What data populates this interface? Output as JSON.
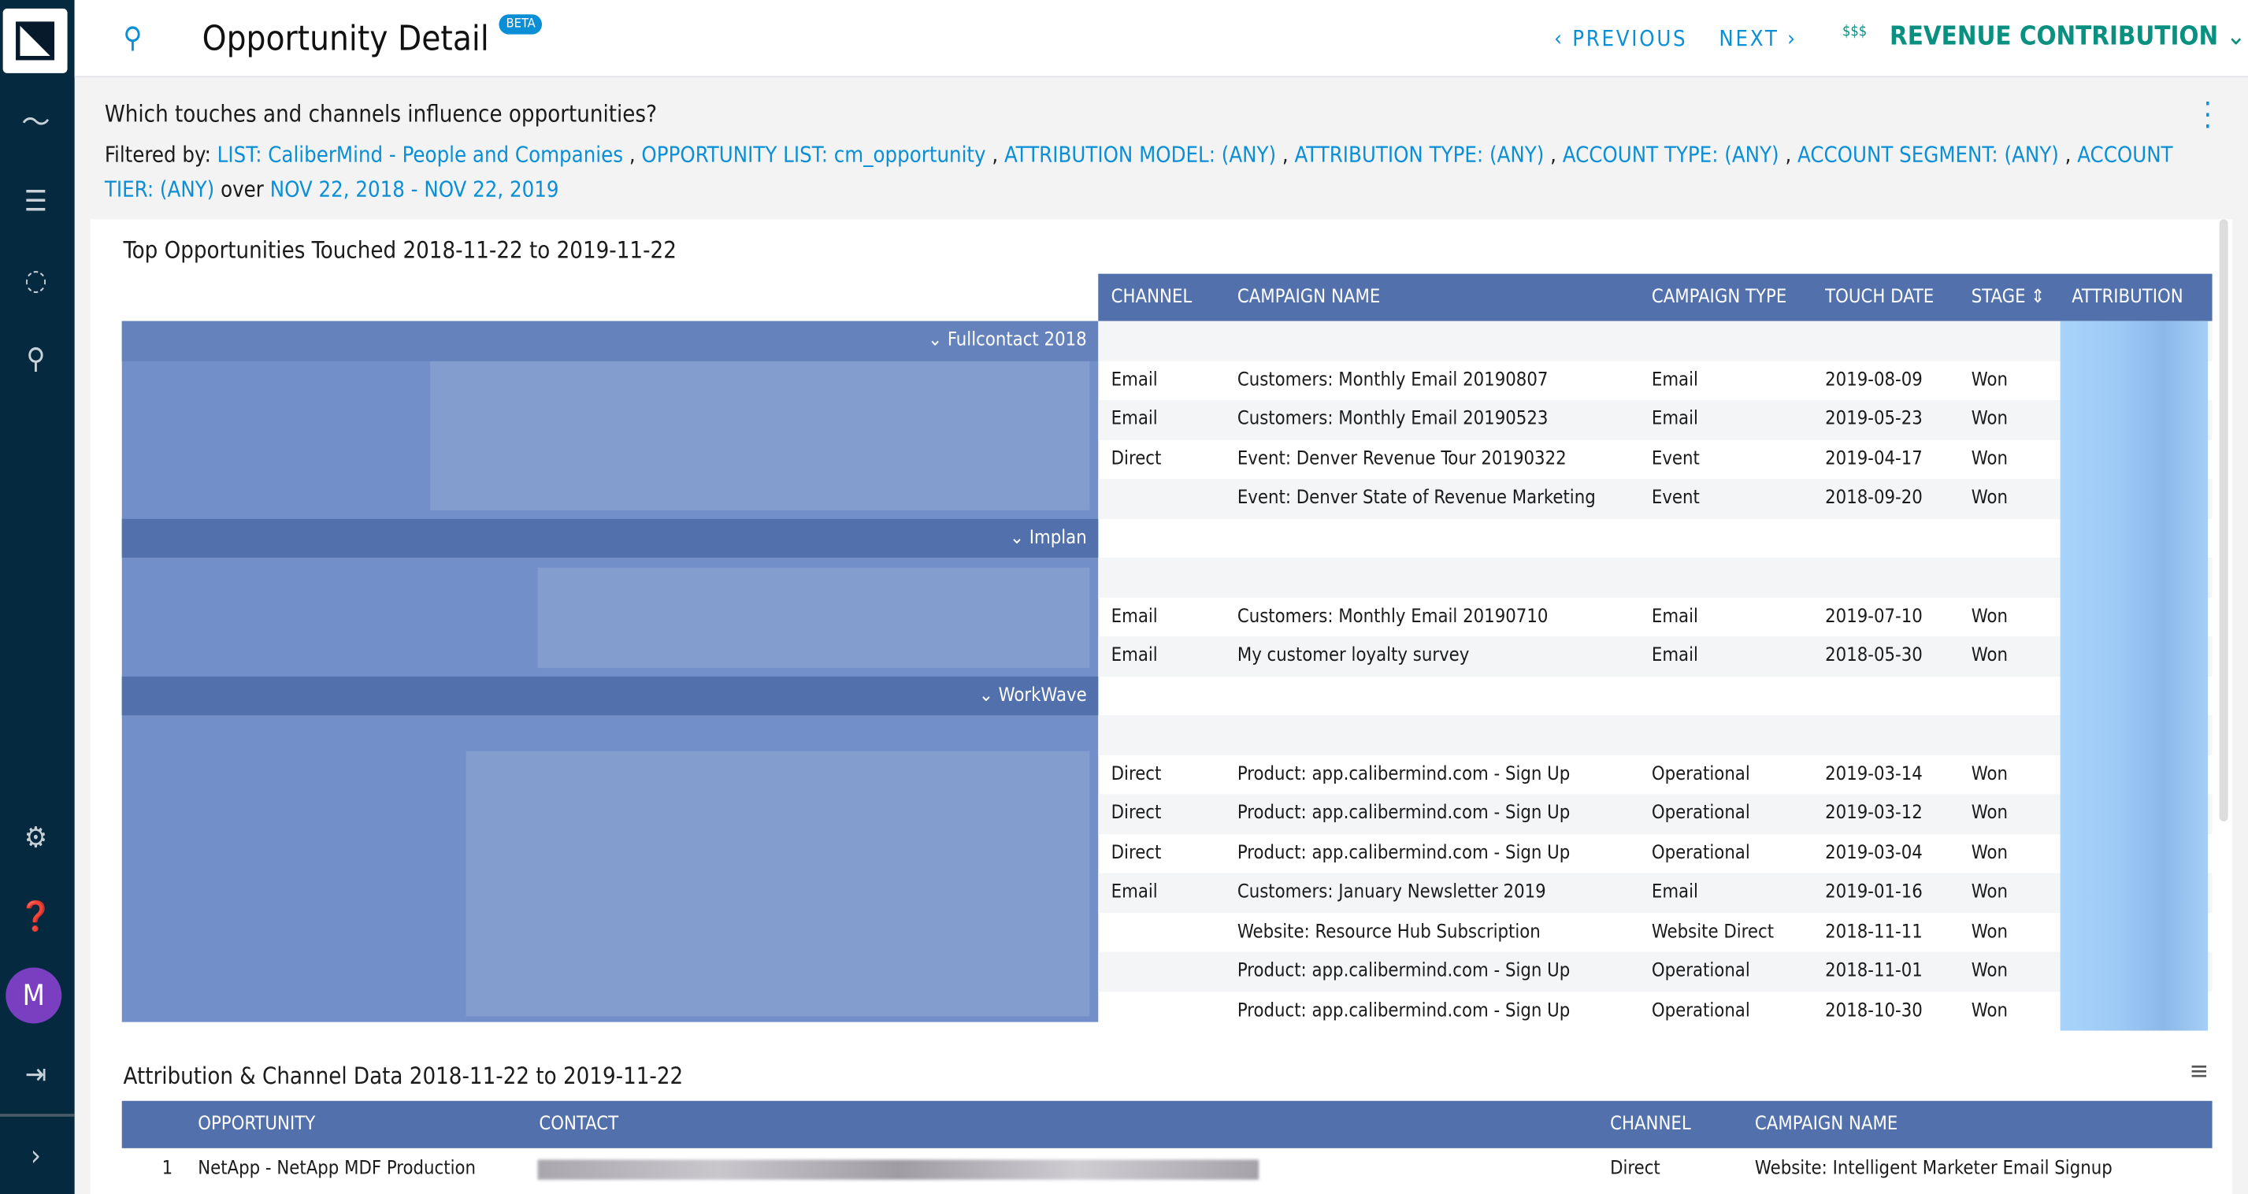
{
  "sidebar": {
    "items": [
      "logo",
      "analytics-icon",
      "list-icon",
      "journey-icon",
      "search-icon",
      "settings-icon",
      "help-icon",
      "logout-icon",
      "expand-icon"
    ],
    "avatar": "M"
  },
  "header": {
    "title": "Opportunity Detail",
    "badge": "BETA",
    "previous": "PREVIOUS",
    "next": "NEXT",
    "view": "REVENUE CONTRIBUTION",
    "view_icon": "$$$"
  },
  "question": "Which touches and channels influence opportunities?",
  "filters": {
    "label": "Filtered by:",
    "items": [
      "LIST: CaliberMind - People and Companies",
      "OPPORTUNITY LIST: cm_opportunity",
      "ATTRIBUTION MODEL: (ANY)",
      "ATTRIBUTION TYPE: (ANY)",
      "ACCOUNT TYPE: (ANY)",
      "ACCOUNT SEGMENT: (ANY)",
      "ACCOUNT TIER: (ANY)"
    ],
    "over": "over",
    "range": "NOV 22, 2018 - NOV 22, 2019"
  },
  "top": {
    "title": "Top Opportunities Touched 2018-11-22 to 2019-11-22",
    "columns": [
      "CHANNEL",
      "CAMPAIGN NAME",
      "CAMPAIGN TYPE",
      "TOUCH DATE",
      "STAGE",
      "ATTRIBUTION"
    ],
    "groups": [
      "Fullcontact 2018",
      "Implan",
      "WorkWave"
    ],
    "rows": [
      [
        "",
        "",
        "",
        "",
        ""
      ],
      [
        "Email",
        "Customers: Monthly Email 20190807",
        "Email",
        "2019-08-09",
        "Won"
      ],
      [
        "Email",
        "Customers: Monthly Email 20190523",
        "Email",
        "2019-05-23",
        "Won"
      ],
      [
        "Direct",
        "Event: Denver Revenue Tour 20190322",
        "Event",
        "2019-04-17",
        "Won"
      ],
      [
        "",
        "Event: Denver State of Revenue Marketing",
        "Event",
        "2018-09-20",
        "Won"
      ],
      [
        "",
        "",
        "",
        "",
        ""
      ],
      [
        "",
        "",
        "",
        "",
        ""
      ],
      [
        "Email",
        "Customers: Monthly Email 20190710",
        "Email",
        "2019-07-10",
        "Won"
      ],
      [
        "Email",
        "My customer loyalty survey",
        "Email",
        "2018-05-30",
        "Won"
      ],
      [
        "",
        "",
        "",
        "",
        ""
      ],
      [
        "",
        "",
        "",
        "",
        ""
      ],
      [
        "Direct",
        "Product: app.calibermind.com - Sign Up",
        "Operational",
        "2019-03-14",
        "Won"
      ],
      [
        "Direct",
        "Product: app.calibermind.com - Sign Up",
        "Operational",
        "2019-03-12",
        "Won"
      ],
      [
        "Direct",
        "Product: app.calibermind.com - Sign Up",
        "Operational",
        "2019-03-04",
        "Won"
      ],
      [
        "Email",
        "Customers: January Newsletter 2019",
        "Email",
        "2019-01-16",
        "Won"
      ],
      [
        "",
        "Website: Resource Hub Subscription",
        "Website Direct",
        "2018-11-11",
        "Won"
      ],
      [
        "",
        "Product: app.calibermind.com - Sign Up",
        "Operational",
        "2018-11-01",
        "Won"
      ],
      [
        "",
        "Product: app.calibermind.com - Sign Up",
        "Operational",
        "2018-10-30",
        "Won"
      ]
    ]
  },
  "bottom": {
    "title": "Attribution & Channel Data 2018-11-22 to 2019-11-22",
    "columns": [
      "OPPORTUNITY",
      "CONTACT",
      "CHANNEL",
      "CAMPAIGN NAME"
    ],
    "rows": [
      [
        "1",
        "NetApp - NetApp MDF Production",
        "",
        "Direct",
        "Website: Intelligent Marketer Email Signup"
      ]
    ]
  },
  "colors": {
    "header_blue": "#5270ab",
    "link": "#0a8fd6",
    "revenue_green": "#0a9080",
    "sidebar": "#052a40"
  }
}
